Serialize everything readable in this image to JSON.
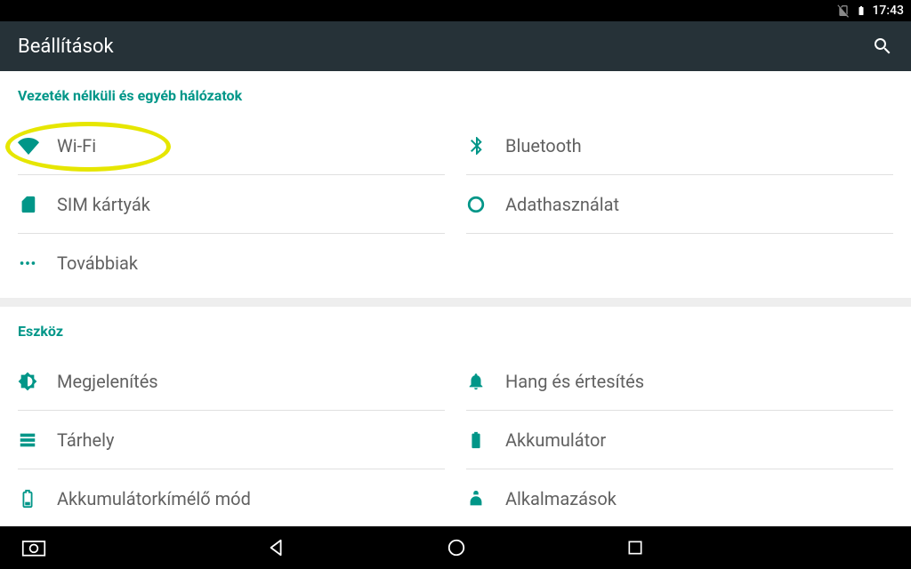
{
  "status": {
    "time": "17:43"
  },
  "appbar": {
    "title": "Beállítások"
  },
  "sections": {
    "wireless_header": "Vezeték nélküli és egyéb hálózatok",
    "device_header": "Eszköz"
  },
  "items": {
    "wifi": "Wi-Fi",
    "bluetooth": "Bluetooth",
    "sim": "SIM kártyák",
    "datausage": "Adathasználat",
    "more": "Továbbiak",
    "display": "Megjelenítés",
    "sound": "Hang és értesítés",
    "storage": "Tárhely",
    "battery": "Akkumulátor",
    "batterysaver": "Akkumulátorkímélő mód",
    "apps": "Alkalmazások"
  },
  "colors": {
    "accent": "#009688",
    "highlight": "#e6e600",
    "appbar": "#263238"
  }
}
